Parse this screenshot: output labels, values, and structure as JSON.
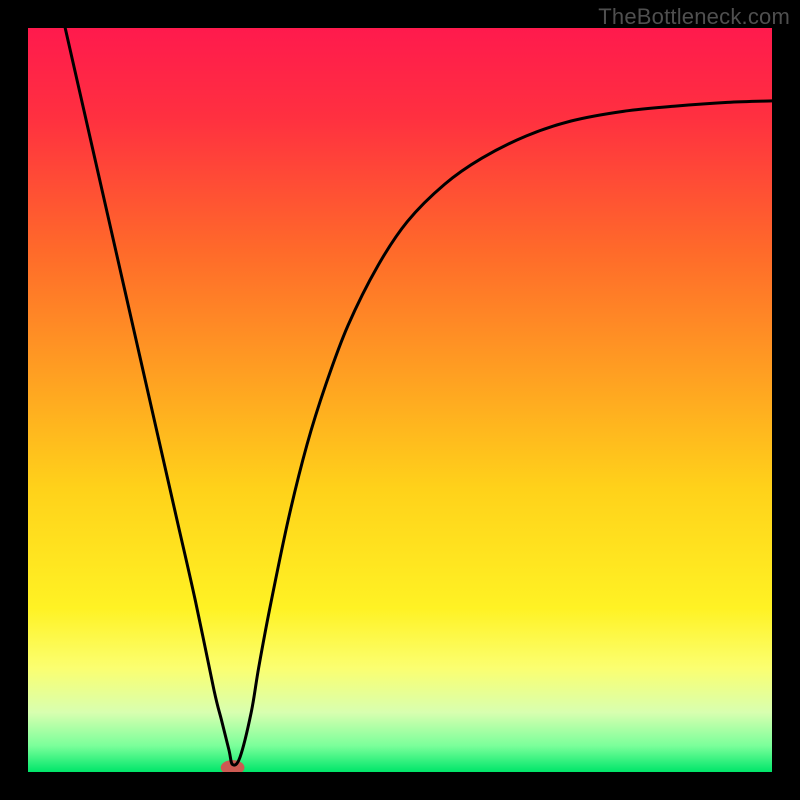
{
  "watermark": "TheBottleneck.com",
  "chart_data": {
    "type": "line",
    "title": "",
    "xlabel": "",
    "ylabel": "",
    "xlim": [
      0,
      1
    ],
    "ylim": [
      0,
      1
    ],
    "grid": false,
    "legend": false,
    "background_gradient": {
      "stops": [
        {
          "offset": 0.0,
          "color": "#ff1a4d"
        },
        {
          "offset": 0.12,
          "color": "#ff3040"
        },
        {
          "offset": 0.3,
          "color": "#ff6a2a"
        },
        {
          "offset": 0.48,
          "color": "#ffa421"
        },
        {
          "offset": 0.62,
          "color": "#ffd21a"
        },
        {
          "offset": 0.78,
          "color": "#fff224"
        },
        {
          "offset": 0.86,
          "color": "#fbff70"
        },
        {
          "offset": 0.92,
          "color": "#d8ffb0"
        },
        {
          "offset": 0.965,
          "color": "#7aff9a"
        },
        {
          "offset": 1.0,
          "color": "#00e66a"
        }
      ]
    },
    "series": [
      {
        "name": "curve",
        "color": "#000000",
        "width": 3,
        "x": [
          0.05,
          0.075,
          0.1,
          0.125,
          0.15,
          0.175,
          0.2,
          0.225,
          0.25,
          0.26,
          0.27,
          0.275,
          0.285,
          0.3,
          0.31,
          0.325,
          0.35,
          0.375,
          0.4,
          0.43,
          0.47,
          0.51,
          0.56,
          0.61,
          0.67,
          0.73,
          0.8,
          0.87,
          0.94,
          1.0
        ],
        "y": [
          1.0,
          0.89,
          0.78,
          0.67,
          0.56,
          0.45,
          0.34,
          0.23,
          0.11,
          0.07,
          0.03,
          0.01,
          0.02,
          0.08,
          0.14,
          0.22,
          0.34,
          0.44,
          0.52,
          0.6,
          0.68,
          0.74,
          0.79,
          0.825,
          0.855,
          0.875,
          0.888,
          0.895,
          0.9,
          0.902
        ]
      }
    ],
    "marker": {
      "x": 0.275,
      "y": 0.006,
      "rx": 0.016,
      "ry": 0.01,
      "color": "#cc5a52"
    }
  }
}
